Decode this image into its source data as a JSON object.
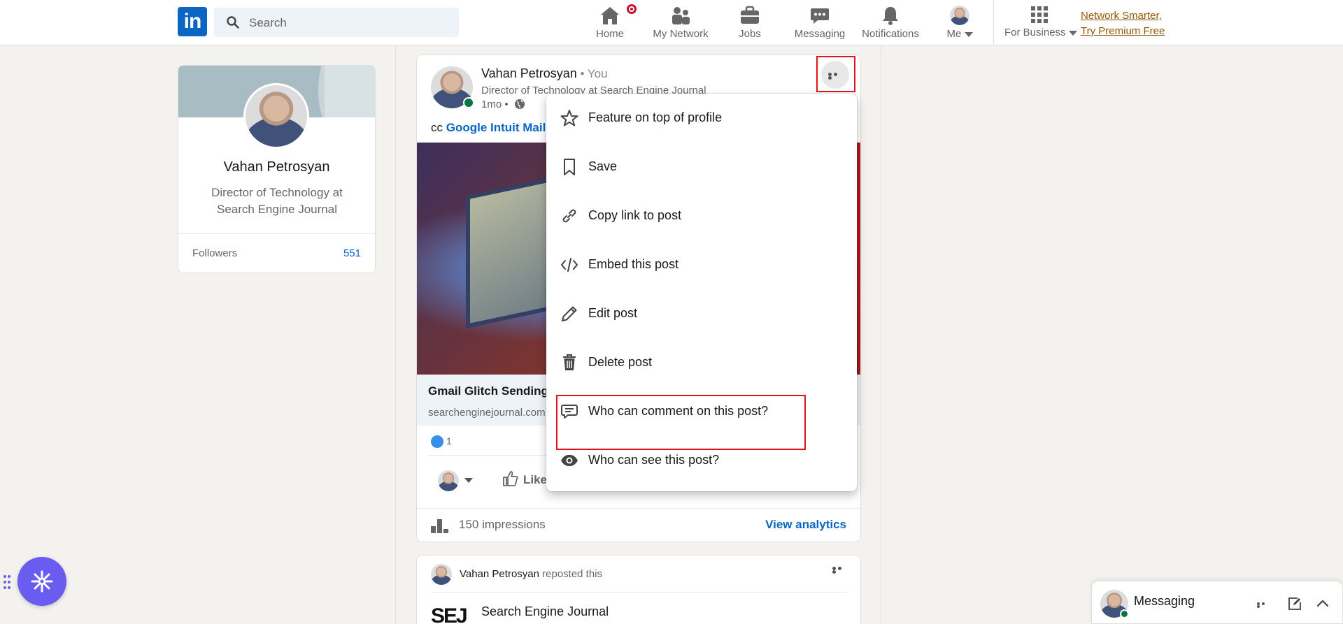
{
  "header": {
    "logo": "in",
    "search_placeholder": "Search",
    "nav": [
      {
        "label": "Home",
        "icon": "home-icon"
      },
      {
        "label": "My Network",
        "icon": "network-icon"
      },
      {
        "label": "Jobs",
        "icon": "briefcase-icon"
      },
      {
        "label": "Messaging",
        "icon": "messaging-icon"
      },
      {
        "label": "Notifications",
        "icon": "bell-icon"
      },
      {
        "label": "Me",
        "icon": "avatar"
      },
      {
        "label": "For Business",
        "icon": "grid-icon"
      }
    ],
    "premium_line1": "Network Smarter,",
    "premium_line2": "Try Premium Free"
  },
  "profile": {
    "name": "Vahan Petrosyan",
    "title": "Director of Technology at Search Engine Journal",
    "followers_label": "Followers",
    "followers_count": "551"
  },
  "post": {
    "author": "Vahan Petrosyan",
    "you": " • You",
    "headline": "Director of Technology at Search Engine Journal",
    "time": "1mo •",
    "cc_prefix": "cc ",
    "cc_link": "Google Intuit Mail",
    "link_title": "Gmail Glitch Sending",
    "link_source": "searchenginejournal.com",
    "reaction_count": "1",
    "like_label": "Like",
    "impressions": "150 impressions",
    "analytics_label": "View analytics"
  },
  "menu": {
    "items": [
      {
        "label": "Feature on top of profile",
        "icon": "star-icon"
      },
      {
        "label": "Save",
        "icon": "bookmark-icon"
      },
      {
        "label": "Copy link to post",
        "icon": "link-icon"
      },
      {
        "label": "Embed this post",
        "icon": "code-icon"
      },
      {
        "label": "Edit post",
        "icon": "pencil-icon"
      },
      {
        "label": "Delete post",
        "icon": "trash-icon"
      },
      {
        "label": "Who can comment on this post?",
        "icon": "comment-icon"
      },
      {
        "label": "Who can see this post?",
        "icon": "eye-icon"
      }
    ]
  },
  "post2": {
    "reposter": "Vahan Petrosyan",
    "reposted_text": " reposted this",
    "source_logo": "SEJ",
    "source_name": "Search Engine Journal"
  },
  "messaging": {
    "label": "Messaging"
  },
  "colors": {
    "brand": "#0a66c2",
    "highlight": "#e0121f",
    "premium": "#915907",
    "assistant": "#6a5cf0"
  }
}
